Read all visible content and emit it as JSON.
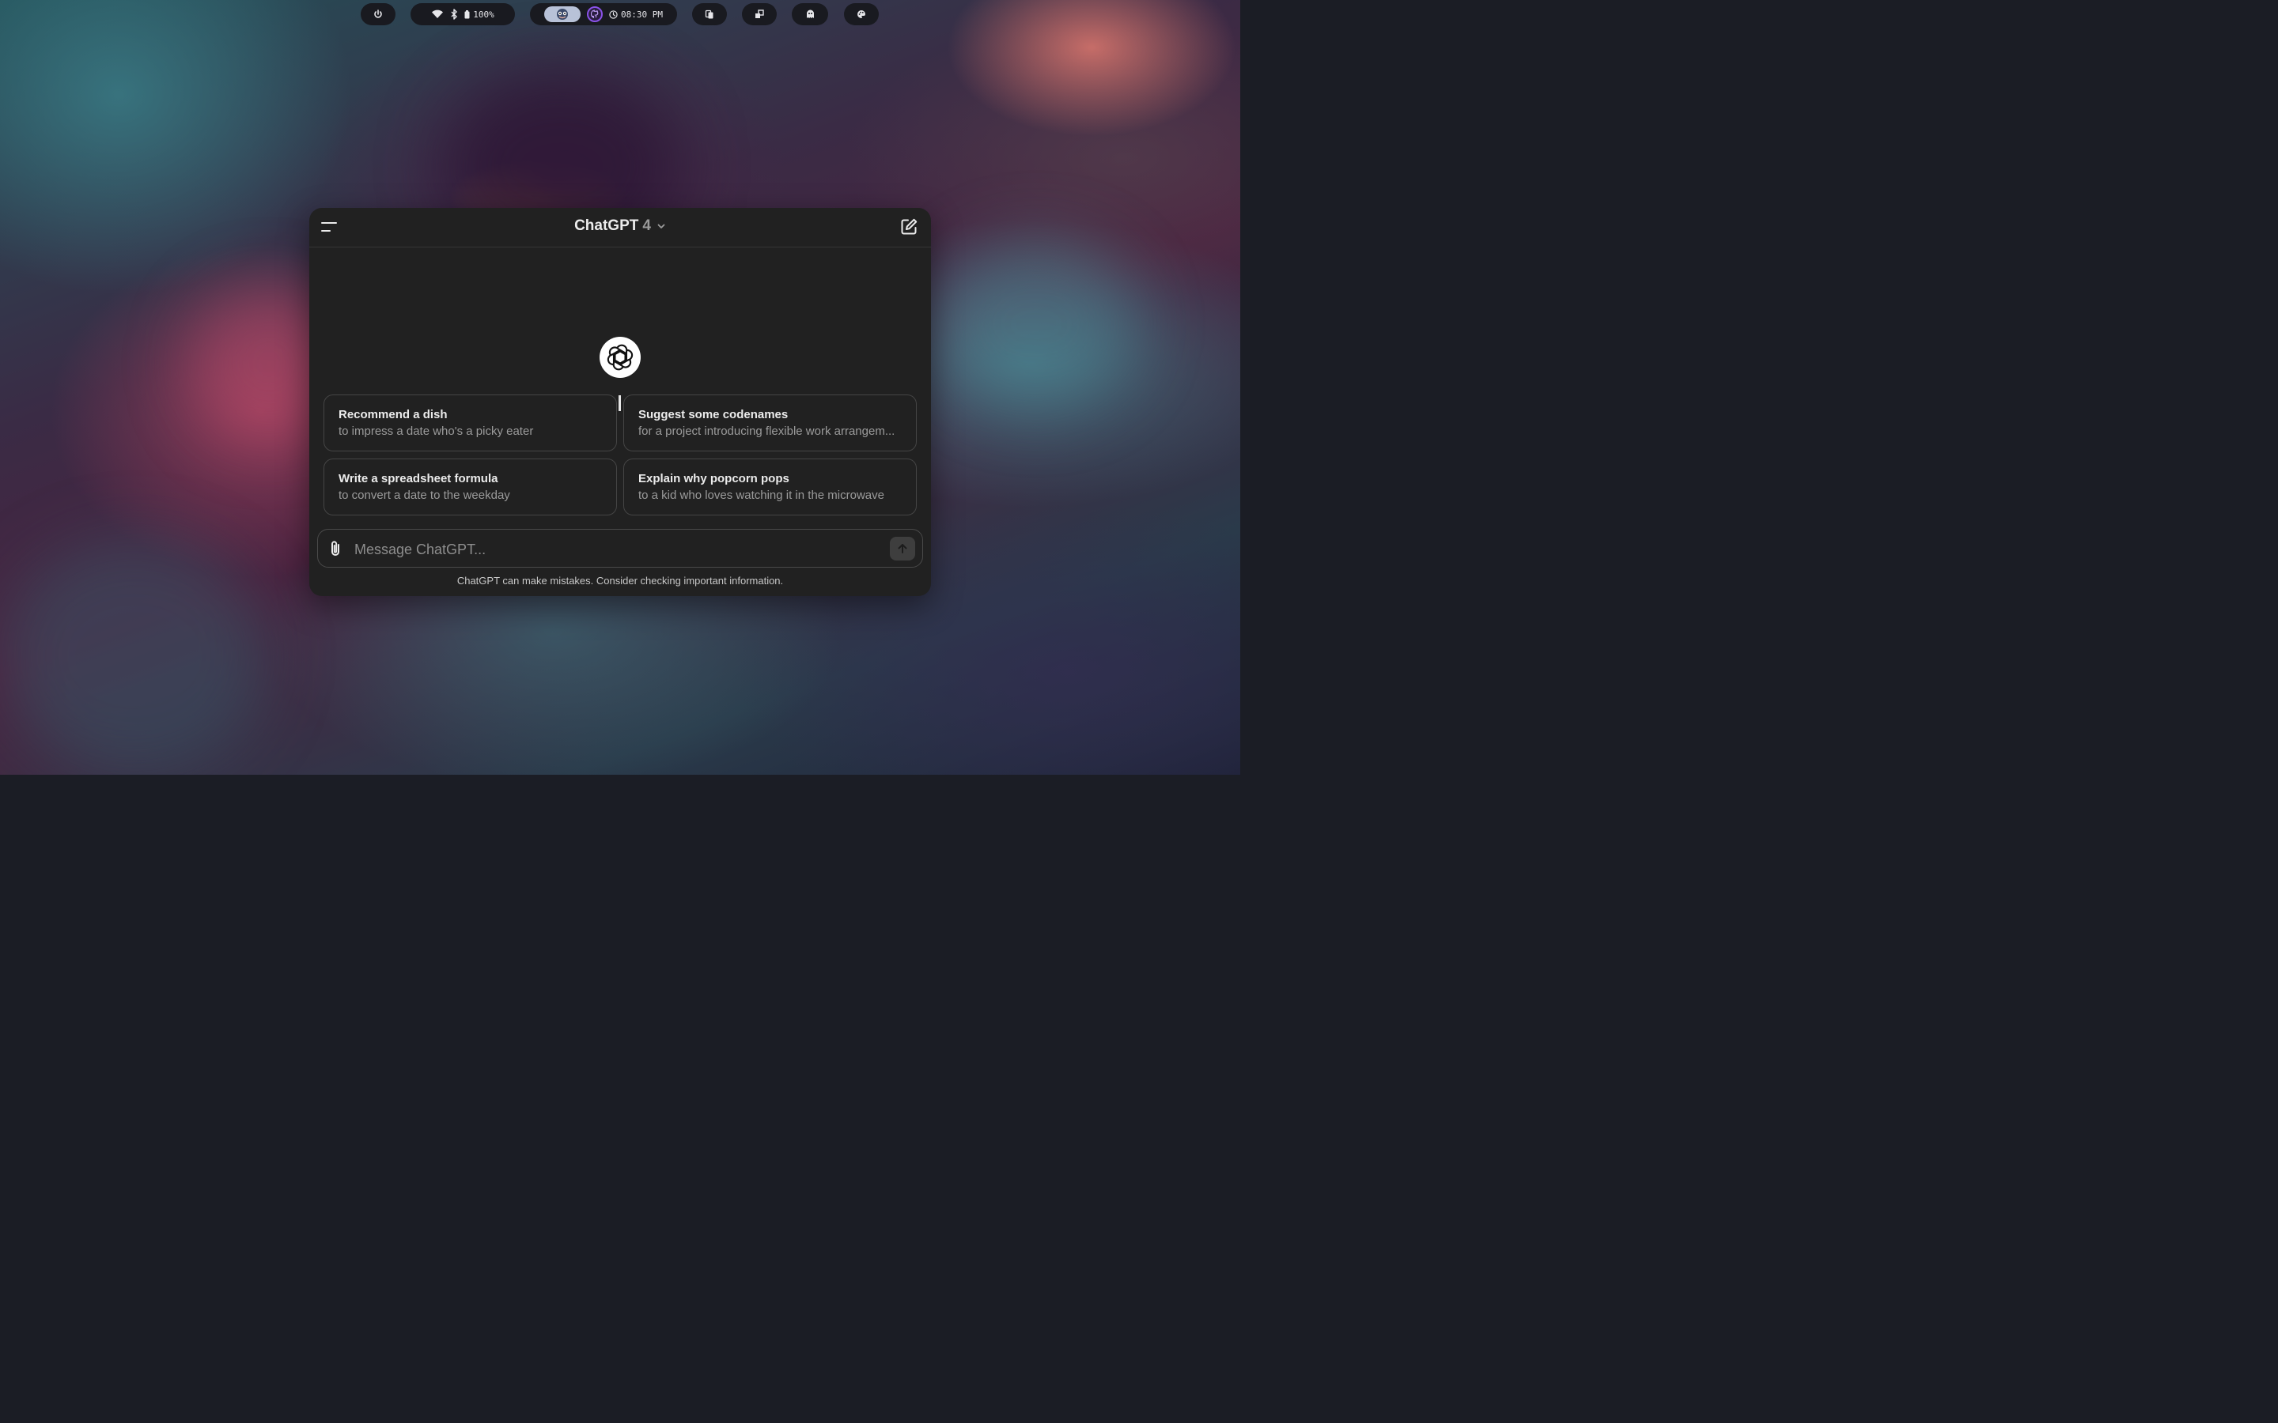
{
  "statusbar": {
    "battery": "100%",
    "clock": "08:30 PM",
    "icons": [
      "power-icon",
      "wifi-icon",
      "bluetooth-icon",
      "battery-icon",
      "avatar-icon",
      "github-icon",
      "clock-icon",
      "clipboard-icon",
      "workspace-icon",
      "ghost-icon",
      "palette-icon"
    ]
  },
  "header": {
    "model_name": "ChatGPT",
    "model_version": "4"
  },
  "suggestions": [
    {
      "title": "Recommend a dish",
      "subtitle": "to impress a date who's a picky eater"
    },
    {
      "title": "Suggest some codenames",
      "subtitle": "for a project introducing flexible work arrangem..."
    },
    {
      "title": "Write a spreadsheet formula",
      "subtitle": "to convert a date to the weekday"
    },
    {
      "title": "Explain why popcorn pops",
      "subtitle": "to a kid who loves watching it in the microwave"
    }
  ],
  "composer": {
    "placeholder": "Message ChatGPT...",
    "value": ""
  },
  "footer": {
    "disclaimer": "ChatGPT can make mistakes. Consider checking important information."
  },
  "colors": {
    "window_bg": "#212121",
    "pill_bg": "#191a20",
    "text": "#ececec",
    "muted": "#9b9b9b"
  }
}
